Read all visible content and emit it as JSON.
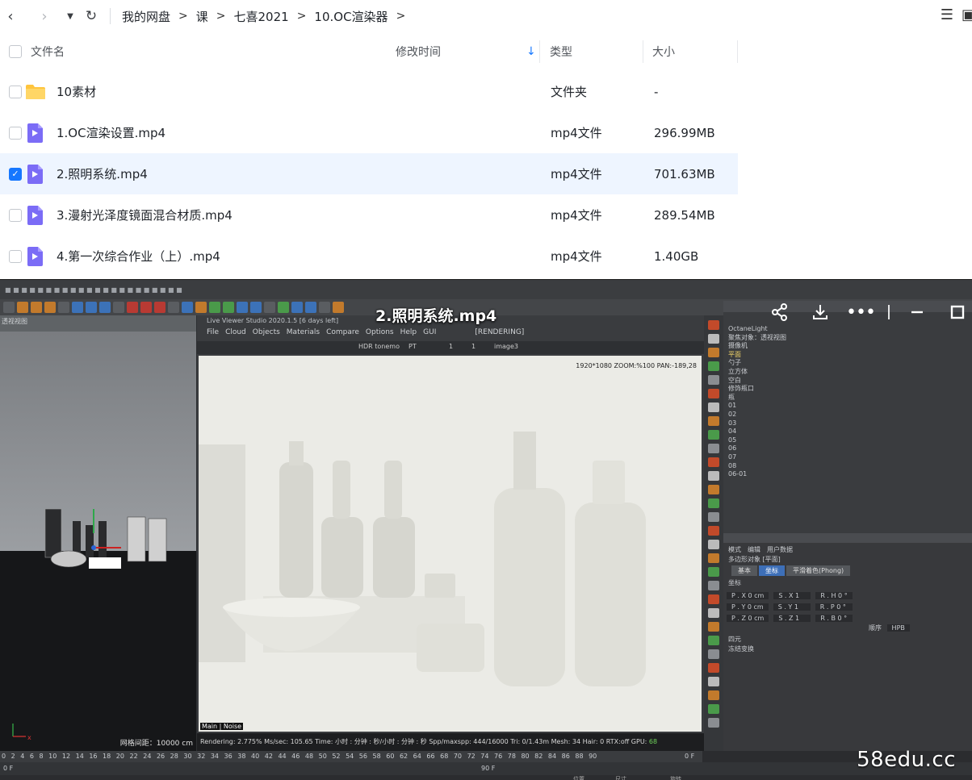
{
  "nav": {
    "breadcrumbs": [
      "我的网盘",
      "课",
      "七喜2021",
      "10.OC渲染器"
    ]
  },
  "list": {
    "headers": {
      "name": "文件名",
      "modified": "修改时间",
      "type": "类型",
      "size": "大小"
    },
    "rows": [
      {
        "name": "10素材",
        "type": "文件夹",
        "size": "-",
        "icon": "folder-icon",
        "checked": false
      },
      {
        "name": "1.OC渲染设置.mp4",
        "type": "mp4文件",
        "size": "296.99MB",
        "icon": "video-file-icon",
        "checked": false
      },
      {
        "name": "2.照明系统.mp4",
        "type": "mp4文件",
        "size": "701.63MB",
        "icon": "video-file-icon",
        "checked": true
      },
      {
        "name": "3.漫射光泽度镜面混合材质.mp4",
        "type": "mp4文件",
        "size": "289.54MB",
        "icon": "video-file-icon",
        "checked": false
      },
      {
        "name": "4.第一次综合作业（上）.mp4",
        "type": "mp4文件",
        "size": "1.40GB",
        "icon": "video-file-icon",
        "checked": false
      }
    ]
  },
  "video": {
    "title": "2.照明系统.mp4",
    "c4d": {
      "viewport_label": "透视视图",
      "grid_label": "网格间距：10000 cm",
      "octane_title": "Live Viewer Studio 2020.1.5 [6 days left]",
      "octane_menu": [
        "File",
        "Cloud",
        "Objects",
        "Materials",
        "Compare",
        "Options",
        "Help",
        "GUI"
      ],
      "octane_state": "[RENDERING]",
      "octane_toolbar": [
        "HDR tonemo",
        "PT",
        "1",
        "1",
        "image3"
      ],
      "render_info": "1920*1080 ZOOM:%100 PAN:-189,28",
      "render_tabs": "Main | Noise",
      "status": "Rendering: 2.775% Ms/sec: 105.65   Time: 小时 : 分钟 : 秒/小时 : 分钟 : 秒   Spp/maxspp: 444/16000  Tri: 0/1.43m  Mesh: 34  Hair: 0  RTX:off",
      "gpu_label": "GPU:",
      "gpu_value": "68",
      "objects": [
        "OctaneLight",
        "聚焦对象：透视视图",
        "摄像机",
        "平面",
        "勺子",
        "立方体",
        "空白",
        "修饰瓶口",
        "瓶",
        "01",
        "02",
        "03",
        "04",
        "05",
        "06",
        "07",
        "08",
        "06-01"
      ],
      "attr_modes": [
        "模式",
        "编辑",
        "用户数据"
      ],
      "attr_object": "多边形对象 [平面]",
      "attr_tabs": [
        "基本",
        "坐标",
        "平滑着色(Phong)"
      ],
      "coord_title": "坐标",
      "coords": [
        [
          "P . X  0 cm",
          "S . X  1",
          "R . H  0 °"
        ],
        [
          "P . Y  0 cm",
          "S . Y  1",
          "R . P  0 °"
        ],
        [
          "P . Z  0 cm",
          "S . Z  1",
          "R . B  0 °"
        ]
      ],
      "order_label": "顺序",
      "order_value": "HPB",
      "quaternion": "四元",
      "freeze": "冻结变换",
      "timeline_ticks": "0 2 4 6 8 10 12 14 16 18 20 22 24 26 28 30 32 34 36 38 40 42 44 46 48 50 52 54 56 58 60 62 64 66 68 70 72 74 76 78 80 82 84 86 88 90",
      "frame_start": "0 F",
      "frame_end": "90 F",
      "timeline_end_label": "0 F",
      "bottom_labels": [
        "位置",
        "尺寸",
        "旋转"
      ]
    }
  },
  "watermark": "58edu.cc",
  "colors": {
    "accent": "#1677ff",
    "selected_row": "#eef5ff",
    "video_icon": "#7b6cf6",
    "folder": "#ffc53d"
  }
}
